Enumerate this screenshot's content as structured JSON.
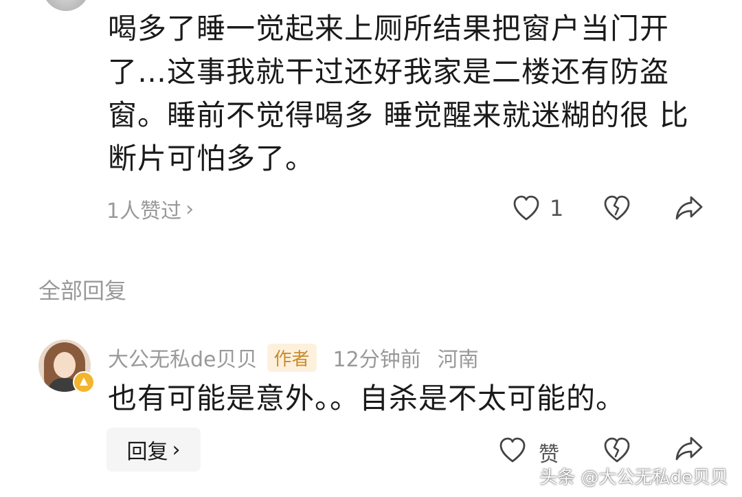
{
  "comment": {
    "text": "喝多了睡一觉起来上厕所结果把窗户当门开了…这事我就干过还好我家是二楼还有防盗窗。睡前不觉得喝多 睡觉醒来就迷糊的很 比断片可怕多了。",
    "liked_by": "1人赞过",
    "like_count": "1"
  },
  "replies_section": {
    "title": "全部回复"
  },
  "reply": {
    "author": "大公无私de贝贝",
    "author_tag": "作者",
    "time": "12分钟前",
    "location": "河南",
    "text": "也有可能是意外。。自杀是不太可能的。",
    "reply_button_label": "回复",
    "like_label": "赞"
  },
  "watermark": "头条 @大公无私de贝贝",
  "colors": {
    "text_primary": "#1a1a1a",
    "text_secondary": "#999999",
    "author_tag_bg": "#fdf1dd",
    "author_tag_text": "#c98a2e",
    "badge": "#f3b52c"
  },
  "icons": [
    "chevron-right-icon",
    "heart-icon",
    "broken-heart-icon",
    "share-icon",
    "level-badge-icon"
  ]
}
